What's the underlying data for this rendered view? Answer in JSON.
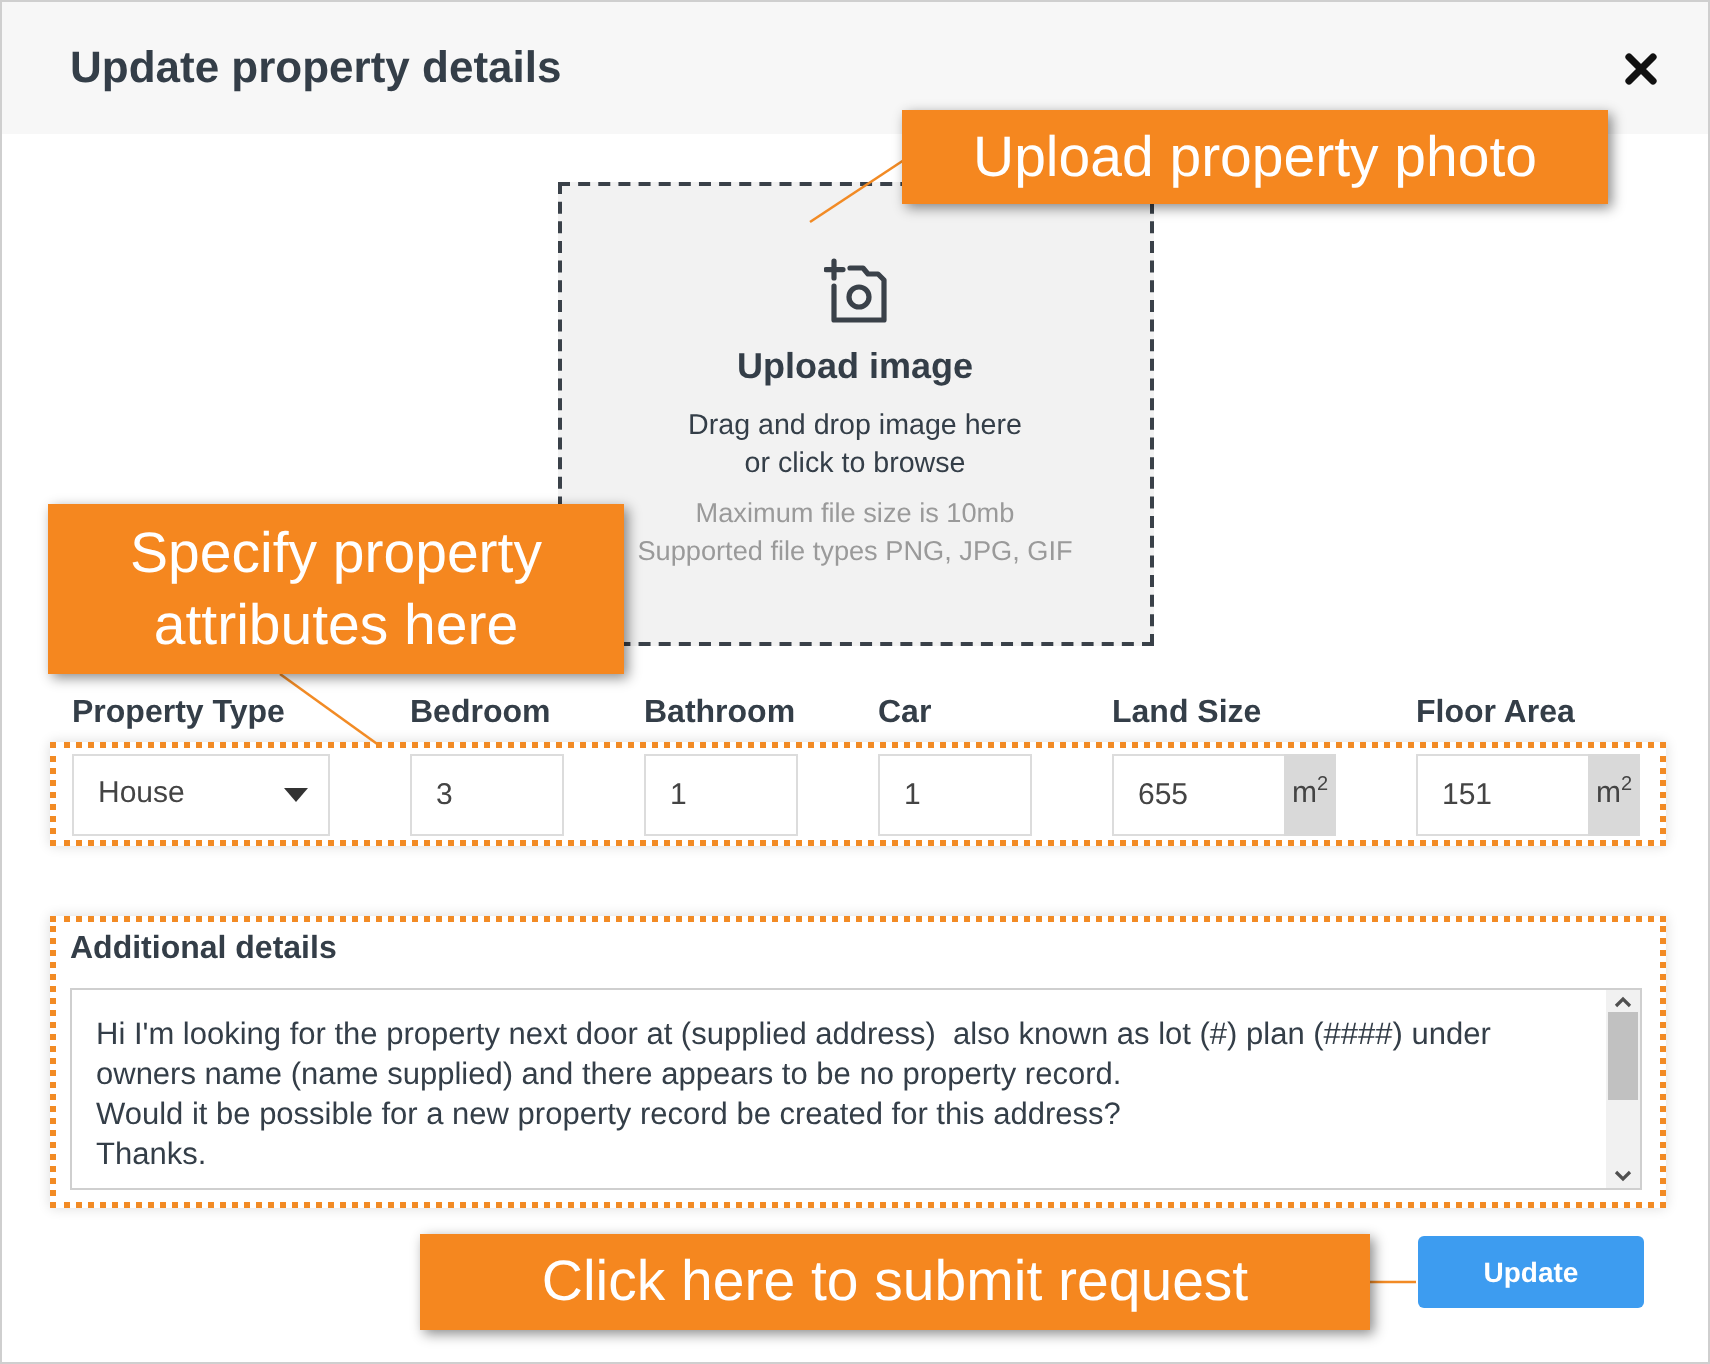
{
  "dialog": {
    "title": "Update property details"
  },
  "upload": {
    "title": "Upload image",
    "instructions": [
      "Drag and drop image here",
      "or click to browse"
    ],
    "limits": [
      "Maximum file size is 10mb",
      "Supported file types PNG, JPG, GIF"
    ]
  },
  "attributes": [
    {
      "kind": "select",
      "label": "Property Type",
      "value": "House"
    },
    {
      "kind": "text",
      "label": "Bedroom",
      "value": "3"
    },
    {
      "kind": "text",
      "label": "Bathroom",
      "value": "1"
    },
    {
      "kind": "text",
      "label": "Car",
      "value": "1"
    },
    {
      "kind": "unit",
      "label": "Land Size",
      "value": "655",
      "unit": "m$^{2}$"
    },
    {
      "kind": "unit",
      "label": "Floor Area",
      "value": "151",
      "unit": "m$^{2}$"
    }
  ],
  "additional_details": {
    "label": "Additional details",
    "value": "Hi I'm looking for the property next door at (supplied address)  also known as lot (#) plan (####) under owners name (name supplied) and there appears to be no property record.\nWould it be possible for a new property record be created for this address?\nThanks."
  },
  "submit_button": {
    "label": "Update"
  },
  "callouts": [
    "Upload property photo",
    "Specify property attributes here",
    "Click here to submit request"
  ]
}
